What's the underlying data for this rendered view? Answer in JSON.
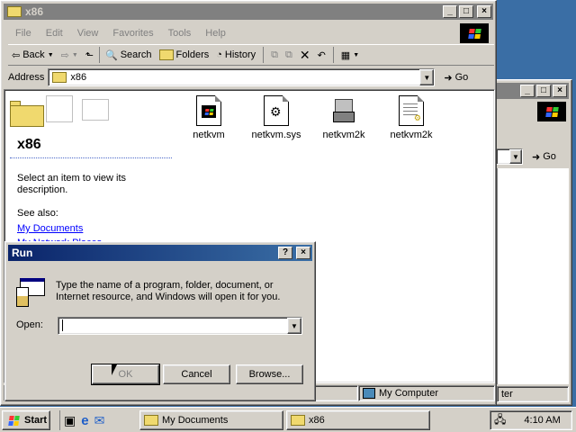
{
  "explorer": {
    "title": "x86",
    "menu": [
      "File",
      "Edit",
      "View",
      "Favorites",
      "Tools",
      "Help"
    ],
    "toolbar": {
      "back": "Back",
      "search": "Search",
      "folders": "Folders",
      "history": "History"
    },
    "address_label": "Address",
    "address_value": "x86",
    "go_label": "Go",
    "folder_heading": "x86",
    "info_text": "Select an item to view its description.",
    "see_also": "See also:",
    "links": [
      "My Documents",
      "My Network Places"
    ],
    "files": [
      {
        "name": "netkvm",
        "icon": "application-icon"
      },
      {
        "name": "netkvm.sys",
        "icon": "system-file-icon"
      },
      {
        "name": "netkvm2k",
        "icon": "setup-icon"
      },
      {
        "name": "netkvm2k",
        "icon": "inf-file-icon"
      }
    ],
    "status_computer": "My Computer"
  },
  "background_window": {
    "go_label": "Go",
    "status_partial": "ter"
  },
  "run_dialog": {
    "title": "Run",
    "help": "?",
    "close": "×",
    "description": "Type the name of a program, folder, document, or Internet resource, and Windows will open it for you.",
    "open_label": "Open:",
    "open_value": "",
    "ok_label": "OK",
    "cancel_label": "Cancel",
    "browse_label": "Browse..."
  },
  "taskbar": {
    "start_label": "Start",
    "tasks": [
      "My Documents",
      "x86"
    ],
    "clock": "4:10 AM"
  }
}
